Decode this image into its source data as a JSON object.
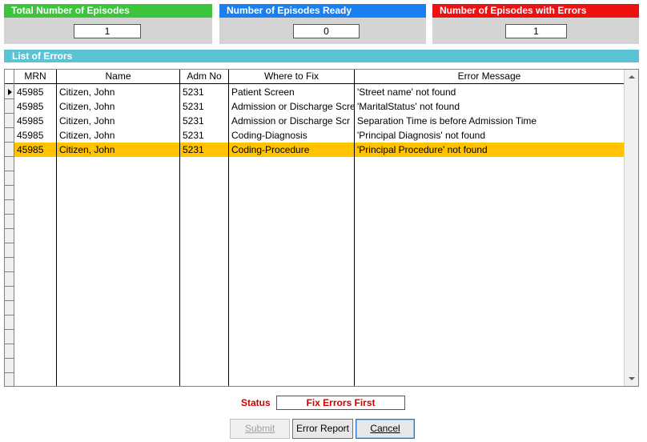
{
  "summary": {
    "total": {
      "label": "Total Number of Episodes",
      "value": "1",
      "color": "#3cc43c"
    },
    "ready": {
      "label": "Number of Episodes Ready",
      "value": "0",
      "color": "#1a7ff0"
    },
    "errors": {
      "label": "Number of Episodes with Errors",
      "value": "1",
      "color": "#ee1111"
    }
  },
  "errors_section": {
    "title": "List of Errors",
    "columns": [
      "MRN",
      "Name",
      "Adm No",
      "Where to Fix",
      "Error Message"
    ],
    "rows": [
      {
        "mrn": "45985",
        "name": "Citizen, John",
        "adm_no": "5231",
        "where": "Patient Screen",
        "message": "'Street name' not found"
      },
      {
        "mrn": "45985",
        "name": "Citizen, John",
        "adm_no": "5231",
        "where": "Admission or Discharge Screen",
        "message": "'MaritalStatus' not found"
      },
      {
        "mrn": "45985",
        "name": "Citizen, John",
        "adm_no": "5231",
        "where": "Admission or Discharge Scr",
        "message": "Separation Time is before Admission Time"
      },
      {
        "mrn": "45985",
        "name": "Citizen, John",
        "adm_no": "5231",
        "where": "Coding-Diagnosis",
        "message": "'Principal Diagnosis' not found"
      },
      {
        "mrn": "45985",
        "name": "Citizen, John",
        "adm_no": "5231",
        "where": "Coding-Procedure",
        "message": "'Principal Procedure' not found"
      }
    ],
    "selected_row": 4
  },
  "status": {
    "label": "Status",
    "value": "Fix Errors First"
  },
  "buttons": {
    "submit": "Submit",
    "error_report": "Error Report",
    "cancel": "Cancel"
  }
}
